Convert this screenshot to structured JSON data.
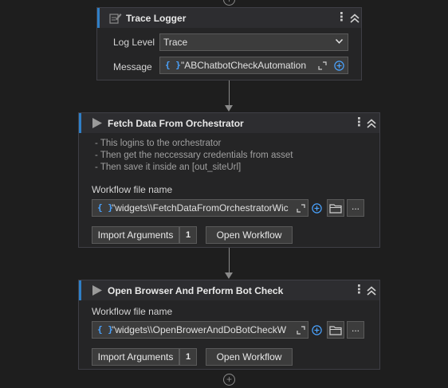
{
  "trace_logger": {
    "title": "Trace Logger",
    "log_level_label": "Log Level",
    "log_level_value": "Trace",
    "message_label": "Message",
    "message_value": "\"ABChatbotCheckAutomation",
    "expression_symbol": "{ }"
  },
  "fetch_data": {
    "title": "Fetch Data From Orchestrator",
    "description": [
      "- This logins to the orchestrator",
      "- Then get the neccessary credentials from asset",
      "- Then save it inside an  [out_siteUrl]"
    ],
    "workflow_label": "Workflow file name",
    "workflow_value": "\"widgets\\\\FetchDataFromOrchestratorWic",
    "expression_symbol": "{ }",
    "browse_label": "...",
    "import_label": "Import Arguments",
    "import_count": "1",
    "open_label": "Open Workflow"
  },
  "open_browser": {
    "title": "Open Browser And Perform Bot Check",
    "workflow_label": "Workflow file name",
    "workflow_value": "\"widgets\\\\OpenBrowerAndDoBotCheckW",
    "expression_symbol": "{ }",
    "browse_label": "...",
    "import_label": "Import Arguments",
    "import_count": "1",
    "open_label": "Open Workflow"
  },
  "glyphs": {
    "kebab": "⋮",
    "plus": "+"
  },
  "icons": [
    "add-activity-icon",
    "trace-logger-icon",
    "invoke-workflow-icon",
    "more-options-icon",
    "collapse-icon",
    "expand-editor-icon",
    "add-variable-icon",
    "folder-icon",
    "dropdown-caret-icon"
  ],
  "colors": {
    "accent": "#2f7fc7",
    "expression": "#4aa3ff",
    "background": "#1e1e1e",
    "card": "#252526"
  }
}
